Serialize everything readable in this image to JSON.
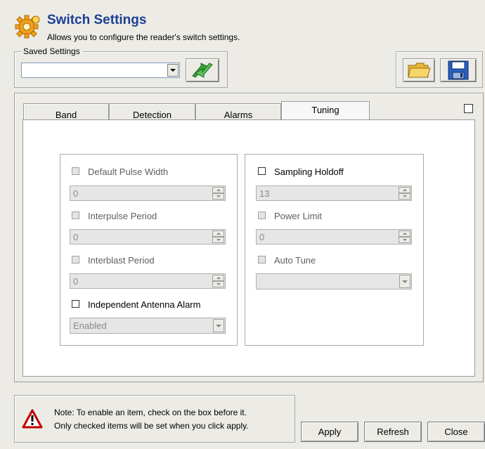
{
  "header": {
    "title": "Switch Settings",
    "subtitle": "Allows you to configure the reader's switch settings."
  },
  "saved_settings": {
    "legend": "Saved Settings",
    "selected": ""
  },
  "tabs": [
    {
      "label": "Band"
    },
    {
      "label": "Detection"
    },
    {
      "label": "Alarms"
    },
    {
      "label": "Tuning"
    }
  ],
  "left_group": {
    "default_pulse_width": {
      "label": "Default Pulse Width",
      "value": "0"
    },
    "interpulse_period": {
      "label": "Interpulse Period",
      "value": "0"
    },
    "interblast_period": {
      "label": "Interblast Period",
      "value": "0"
    },
    "independent_antenna_alarm": {
      "label": "Independent Antenna Alarm",
      "value": "Enabled"
    }
  },
  "right_group": {
    "sampling_holdoff": {
      "label": "Sampling Holdoff",
      "value": "13"
    },
    "power_limit": {
      "label": "Power Limit",
      "value": "0"
    },
    "auto_tune": {
      "label": "Auto Tune",
      "value": ""
    }
  },
  "note": {
    "line1": "Note: To enable an item, check on the box before it.",
    "line2": "Only checked items will be set when you click apply."
  },
  "buttons": {
    "apply": "Apply",
    "refresh": "Refresh",
    "close": "Close"
  },
  "colors": {
    "title": "#1b3f93",
    "background": "#ecebe6",
    "tab_panel": "#ffffff"
  }
}
